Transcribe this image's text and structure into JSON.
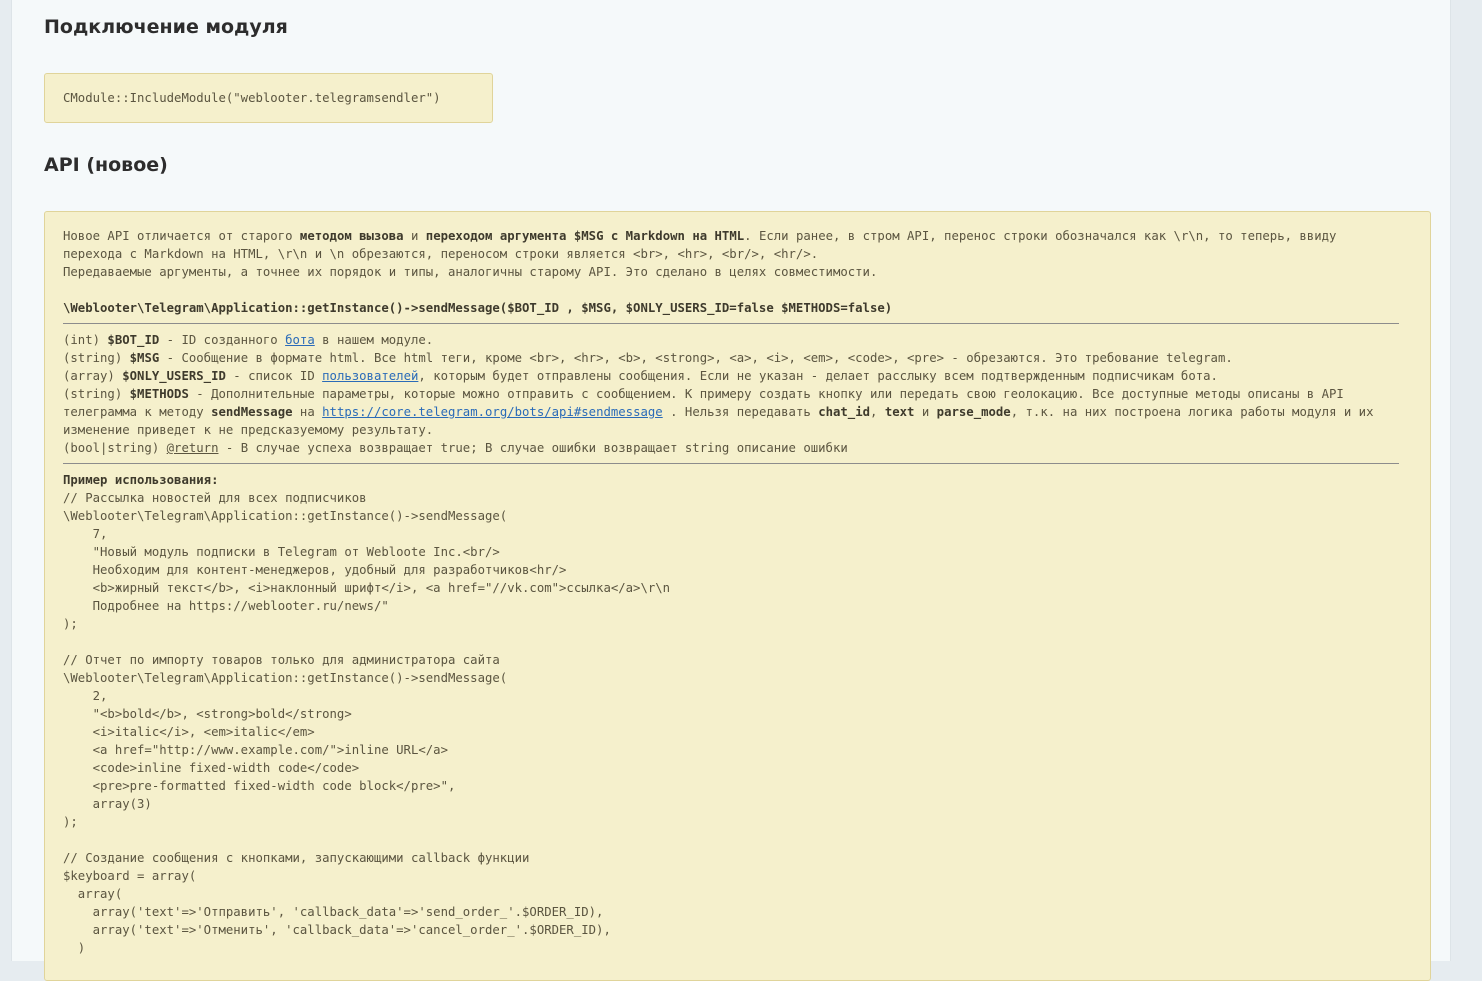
{
  "sections": {
    "connect_title": "Подключение модуля",
    "connect_code": "CModule::IncludeModule(\"weblooter.telegramsendler\")",
    "api_title": "API (новое)"
  },
  "intro": {
    "p1_a": "Новое API отличается от старого ",
    "p1_b": "методом вызова",
    "p1_c": " и ",
    "p1_d": "переходом аргумента $MSG с Markdown на HTML",
    "p1_e": ". Если ранее, в стром API, перенос строки обозначался как \\r\\n, то теперь, ввиду перехода с Markdown на HTML, \\r\\n и \\n обрезаются, переносом строки является <br>, <hr>, <br/>, <hr/>.",
    "p2": "Передаваемые аргументы, а точнее их порядок и типы, аналогичны старому API. Это сделано в целях совместимости.",
    "signature": "\\Weblooter\\Telegram\\Application::getInstance()->sendMessage($BOT_ID , $MSG, $ONLY_USERS_ID=false $METHODS=false)"
  },
  "params": {
    "bot_type": "(int) ",
    "bot_name": "$BOT_ID",
    "bot_desc_a": " - ID созданного ",
    "bot_link": "бота",
    "bot_desc_b": " в нашем модуле.",
    "msg_type": "(string) ",
    "msg_name": "$MSG",
    "msg_desc": " - Сообщение в формате html. Все html теги, кроме <br>, <hr>, <b>, <strong>, <a>, <i>, <em>, <code>, <pre> - обрезаются. Это требование telegram.",
    "users_type": "(array) ",
    "users_name": "$ONLY_USERS_ID",
    "users_desc_a": " - список ID ",
    "users_link": "пользователей",
    "users_desc_b": ", которым будет отправлены сообщения. Если не указан - делает расслыку всем подтвержденным подписчикам бота.",
    "methods_type": "(string) ",
    "methods_name": "$METHODS",
    "methods_desc_a": " - Дополнительные параметры, которые можно отправить с сообщением. К примеру создать кнопку или передать свою геолокацию. Все доступные методы описаны в API телеграмма к методу ",
    "methods_bold1": "sendMessage",
    "methods_desc_b": " на ",
    "methods_link": "https://core.telegram.org/bots/api#sendmessage",
    "methods_desc_c": " . Нельзя передавать ",
    "methods_bold2": "chat_id",
    "methods_sep1": ", ",
    "methods_bold3": "text",
    "methods_sep2": " и ",
    "methods_bold4": "parse_mode",
    "methods_desc_d": ", т.к. на них построена логика работы модуля и их изменение приведет к не предсказуемому результату.",
    "return_type": "(bool|string) ",
    "return_tag": "@return",
    "return_desc": " - В случае успеха возвращает true; В случае ошибки возвращает string описание ошибки"
  },
  "example": {
    "title": "Пример использования:",
    "lines": [
      "// Рассылка новостей для всех подписчиков",
      "\\Weblooter\\Telegram\\Application::getInstance()->sendMessage(",
      "    7,",
      "    \"Новый модуль подписки в Telegram от Webloote Inc.<br/>",
      "    Необходим для контент-менеджеров, удобный для разработчиков<hr/>",
      "    <b>жирный текст</b>, <i>наклонный шрифт</i>, <a href=\"//vk.com\">ссылка</a>\\r\\n",
      "    Подробнее на https://weblooter.ru/news/\"",
      ");",
      "",
      "// Отчет по импорту товаров только для администратора сайта",
      "\\Weblooter\\Telegram\\Application::getInstance()->sendMessage(",
      "    2,",
      "    \"<b>bold</b>, <strong>bold</strong>",
      "    <i>italic</i>, <em>italic</em>",
      "    <a href=\"http://www.example.com/\">inline URL</a>",
      "    <code>inline fixed-width code</code>",
      "    <pre>pre-formatted fixed-width code block</pre>\",",
      "    array(3)",
      ");",
      "",
      "// Создание сообщения с кнопками, запускающими callback функции",
      "$keyboard = array(",
      "  array(",
      "    array('text'=>'Отправить', 'callback_data'=>'send_order_'.$ORDER_ID),",
      "    array('text'=>'Отменить', 'callback_data'=>'cancel_order_'.$ORDER_ID),",
      "  )"
    ]
  }
}
